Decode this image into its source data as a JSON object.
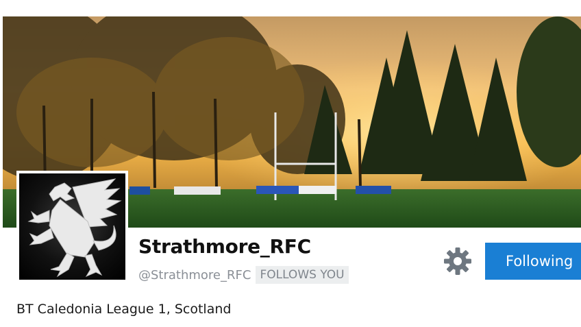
{
  "profile": {
    "display_name": "Strathmore_RFC",
    "handle": "@Strathmore_RFC",
    "follows_you_badge": "FOLLOWS YOU",
    "bio": "BT Caledonia League 1, Scotland"
  },
  "actions": {
    "follow_button_label": "Following",
    "settings_icon": "gear-icon"
  },
  "colors": {
    "follow_button": "#1a7fd4",
    "handle_text": "#8a8f96",
    "badge_background": "#eceeef"
  },
  "avatar": {
    "icon": "griffin-crest-icon"
  }
}
